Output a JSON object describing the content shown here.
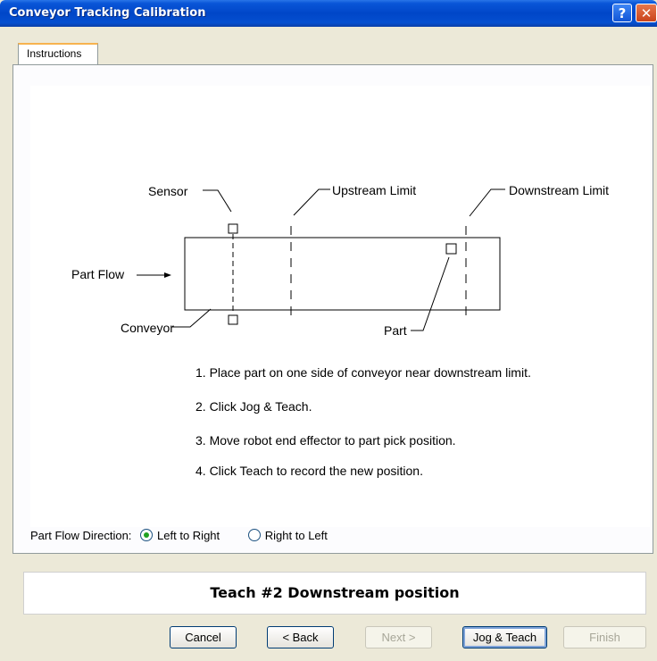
{
  "window": {
    "title": "Conveyor Tracking Calibration",
    "help_label": "?",
    "close_label": "✕"
  },
  "tabs": [
    {
      "label": "Instructions"
    }
  ],
  "diagram": {
    "sensor": "Sensor",
    "upstream_limit": "Upstream Limit",
    "downstream_limit": "Downstream Limit",
    "part_flow": "Part Flow",
    "conveyor": "Conveyor",
    "part": "Part"
  },
  "steps": [
    "1. Place part on one side of conveyor near downstream limit.",
    "2. Click Jog & Teach.",
    "3. Move robot end effector to part pick position.",
    "4. Click Teach to record the new position."
  ],
  "part_flow_direction": {
    "label": "Part Flow Direction:",
    "options": [
      {
        "label": "Left to Right",
        "selected": true
      },
      {
        "label": "Right to Left",
        "selected": false
      }
    ]
  },
  "status_text": "Teach #2 Downstream position",
  "buttons": {
    "cancel": "Cancel",
    "back": "< Back",
    "next": "Next >",
    "jog_teach": "Jog & Teach",
    "finish": "Finish"
  }
}
